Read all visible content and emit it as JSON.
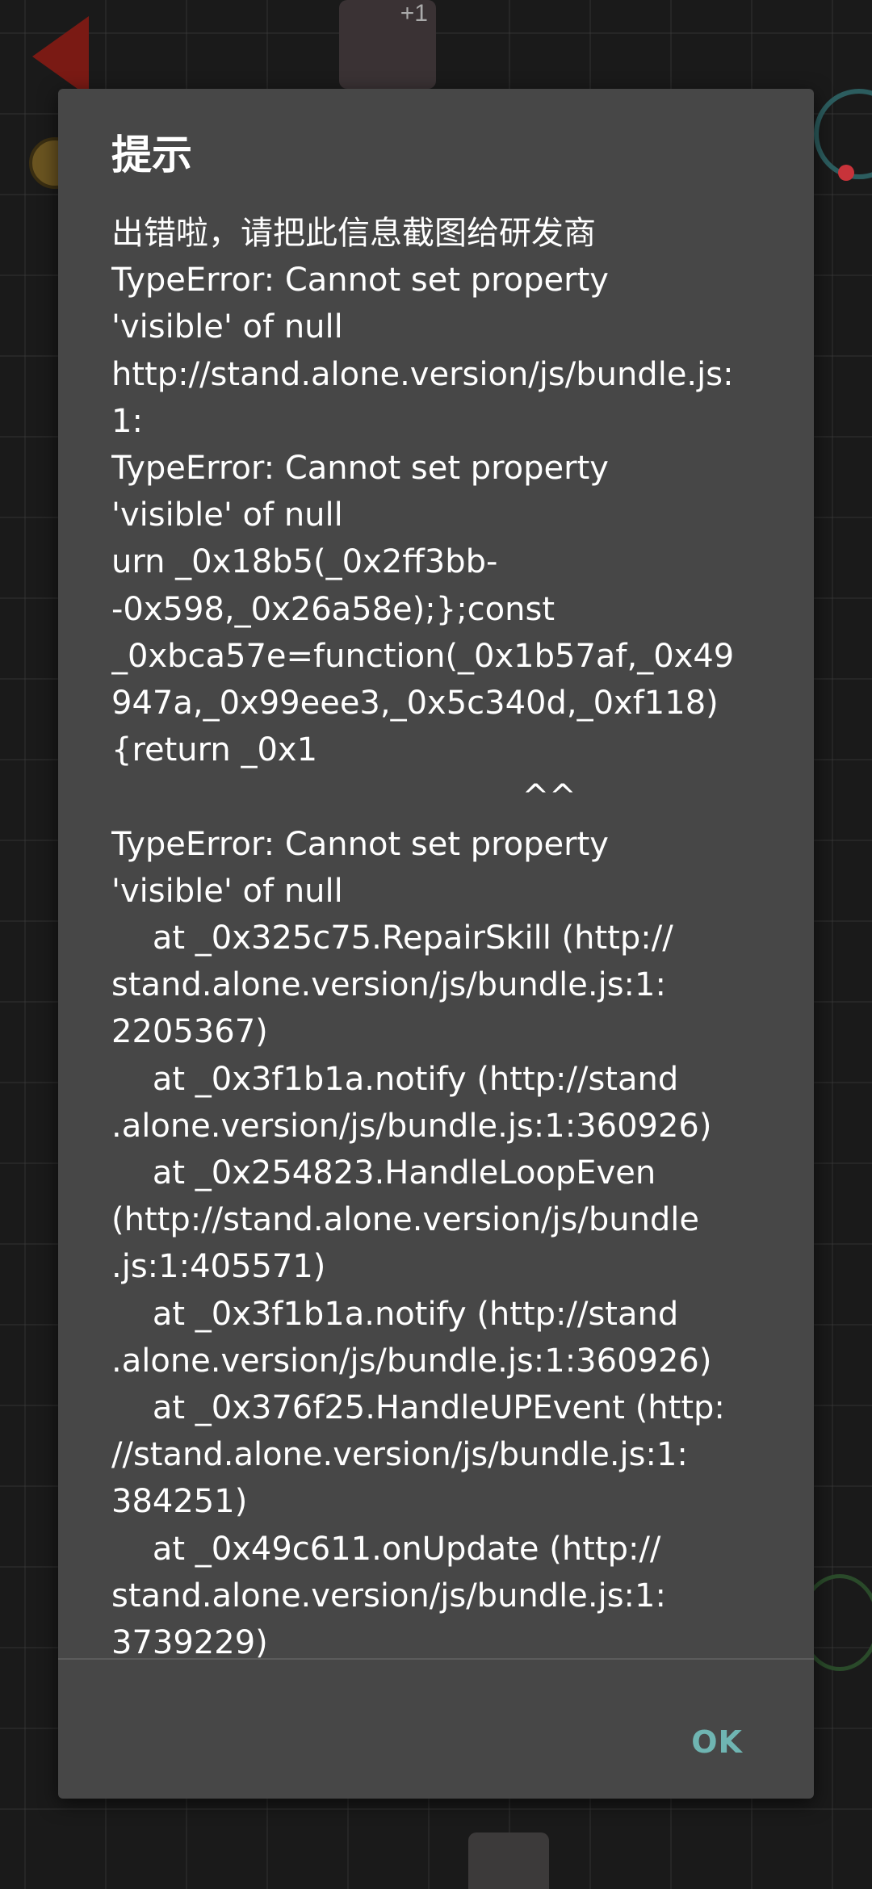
{
  "background": {
    "chip_label": "+1"
  },
  "dialog": {
    "title": "提示",
    "message_lines": [
      "出错啦，请把此信息截图给研发商",
      "TypeError: Cannot set property",
      "'visible' of null",
      "http://stand.alone.version/js/bundle.js:",
      "1:",
      "TypeError: Cannot set property",
      "'visible' of null",
      "urn _0x18b5(_0x2ff3bb-",
      "-0x598,_0x26a58e);};const",
      "_0xbca57e=function(_0x1b57af,_0x49",
      "947a,_0x99eee3,_0x5c340d,_0xf118)",
      "{return _0x1",
      "                                        ^^",
      "TypeError: Cannot set property",
      "'visible' of null",
      "    at _0x325c75.RepairSkill (http://",
      "stand.alone.version/js/bundle.js:1:",
      "2205367)",
      "    at _0x3f1b1a.notify (http://stand",
      ".alone.version/js/bundle.js:1:360926)",
      "    at _0x254823.HandleLoopEven",
      "(http://stand.alone.version/js/bundle",
      ".js:1:405571)",
      "    at _0x3f1b1a.notify (http://stand",
      ".alone.version/js/bundle.js:1:360926)",
      "    at _0x376f25.HandleUPEvent (http:",
      "//stand.alone.version/js/bundle.js:1:",
      "384251)",
      "    at _0x49c611.onUpdate (http://",
      "stand.alone.version/js/bundle.js:1:",
      "3739229)"
    ],
    "ok_label": "OK"
  },
  "colors": {
    "dialog_bg": "#474747",
    "accent": "#6fb5b2",
    "text": "#ffffff"
  }
}
